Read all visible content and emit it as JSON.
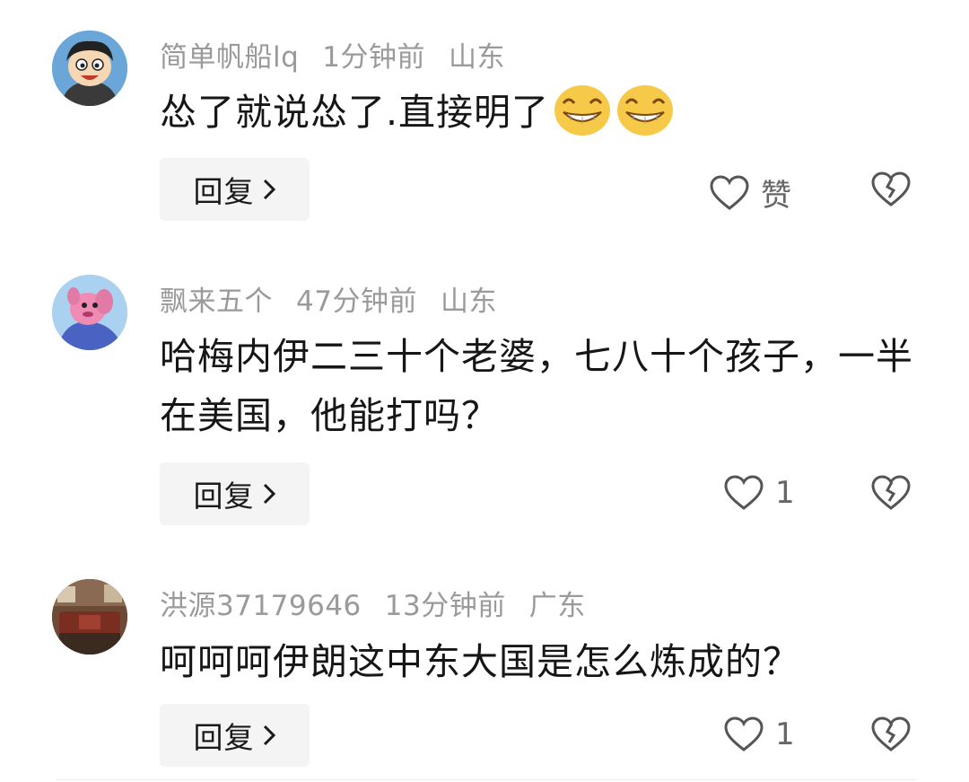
{
  "comments": [
    {
      "username": "简单帆船lq",
      "time": "1分钟前",
      "location": "山东",
      "text": "怂了就说怂了.直接明了",
      "emojis": [
        "grin-emoji",
        "grin-emoji"
      ],
      "reply_label": "回复",
      "like_label": "赞",
      "avatar_icon": "cartoon-face-avatar"
    },
    {
      "username": "飘来五个",
      "time": "47分钟前",
      "location": "山东",
      "text": "哈梅内伊二三十个老婆，七八十个孩子，一半在美国，他能打吗？",
      "reply_label": "回复",
      "like_label": "1",
      "avatar_icon": "pink-dog-avatar"
    },
    {
      "username": "洪源37179646",
      "time": "13分钟前",
      "location": "广东",
      "text": "呵呵呵伊朗这中东大国是怎么炼成的？",
      "reply_label": "回复",
      "like_label": "1",
      "avatar_icon": "room-photo-avatar"
    }
  ],
  "icons": {
    "like": "heart-outline-icon",
    "dislike": "broken-heart-icon",
    "chevron": "chevron-right-icon"
  },
  "colors": {
    "meta_text": "#9a9a9a",
    "body_text": "#161616",
    "reply_bg": "#f4f4f4",
    "icon_stroke": "#555555"
  }
}
